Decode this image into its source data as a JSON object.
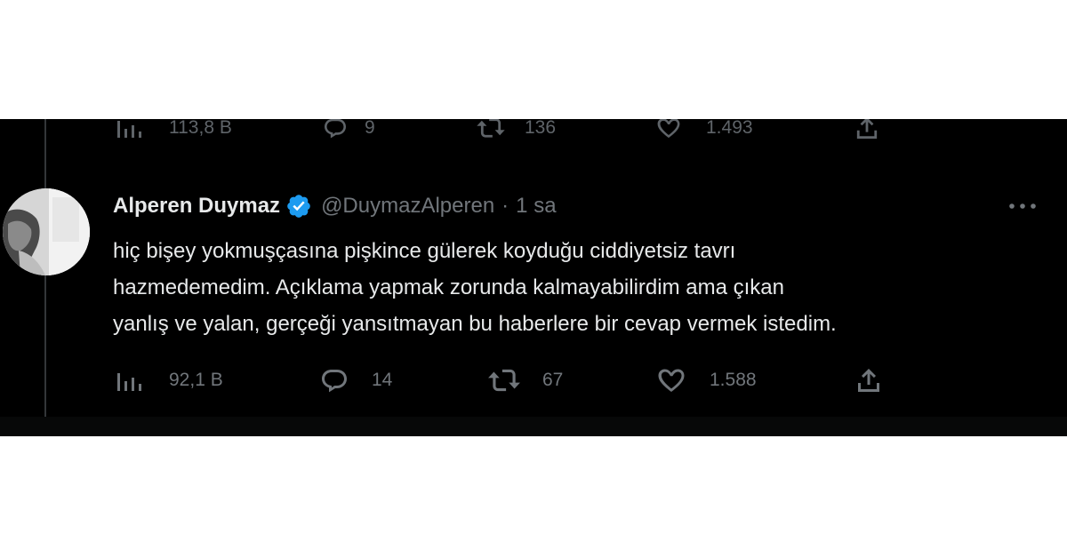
{
  "previous_tweet": {
    "actions": {
      "views": "113,8 B",
      "replies": "9",
      "retweets": "136",
      "likes": "1.493"
    }
  },
  "tweet": {
    "author_name": "Alperen Duymaz",
    "handle": "@DuymazAlperen",
    "separator": "·",
    "time": "1 sa",
    "text": "hiç bişey yokmuşçasına pişkince gülerek koyduğu ciddiyetsiz tavrı\nhazmedemedim. Açıklama yapmak zorunda kalmayabilirdim ama çıkan\nyanlış ve yalan, gerçeği yansıtmayan bu haberlere bir cevap vermek istedim.",
    "actions": {
      "views": "92,1 B",
      "replies": "14",
      "retweets": "67",
      "likes": "1.588"
    }
  },
  "icons": {
    "views": "views-chart-icon",
    "reply": "reply-bubble-icon",
    "retweet": "retweet-arrows-icon",
    "like": "heart-icon",
    "share": "share-upload-icon",
    "more": "more-dots-icon",
    "verified": "verified-badge-icon"
  },
  "colors": {
    "background": "#000000",
    "text_primary": "#e7e9ea",
    "text_secondary": "#71767b",
    "verified": "#1d9bf0"
  }
}
